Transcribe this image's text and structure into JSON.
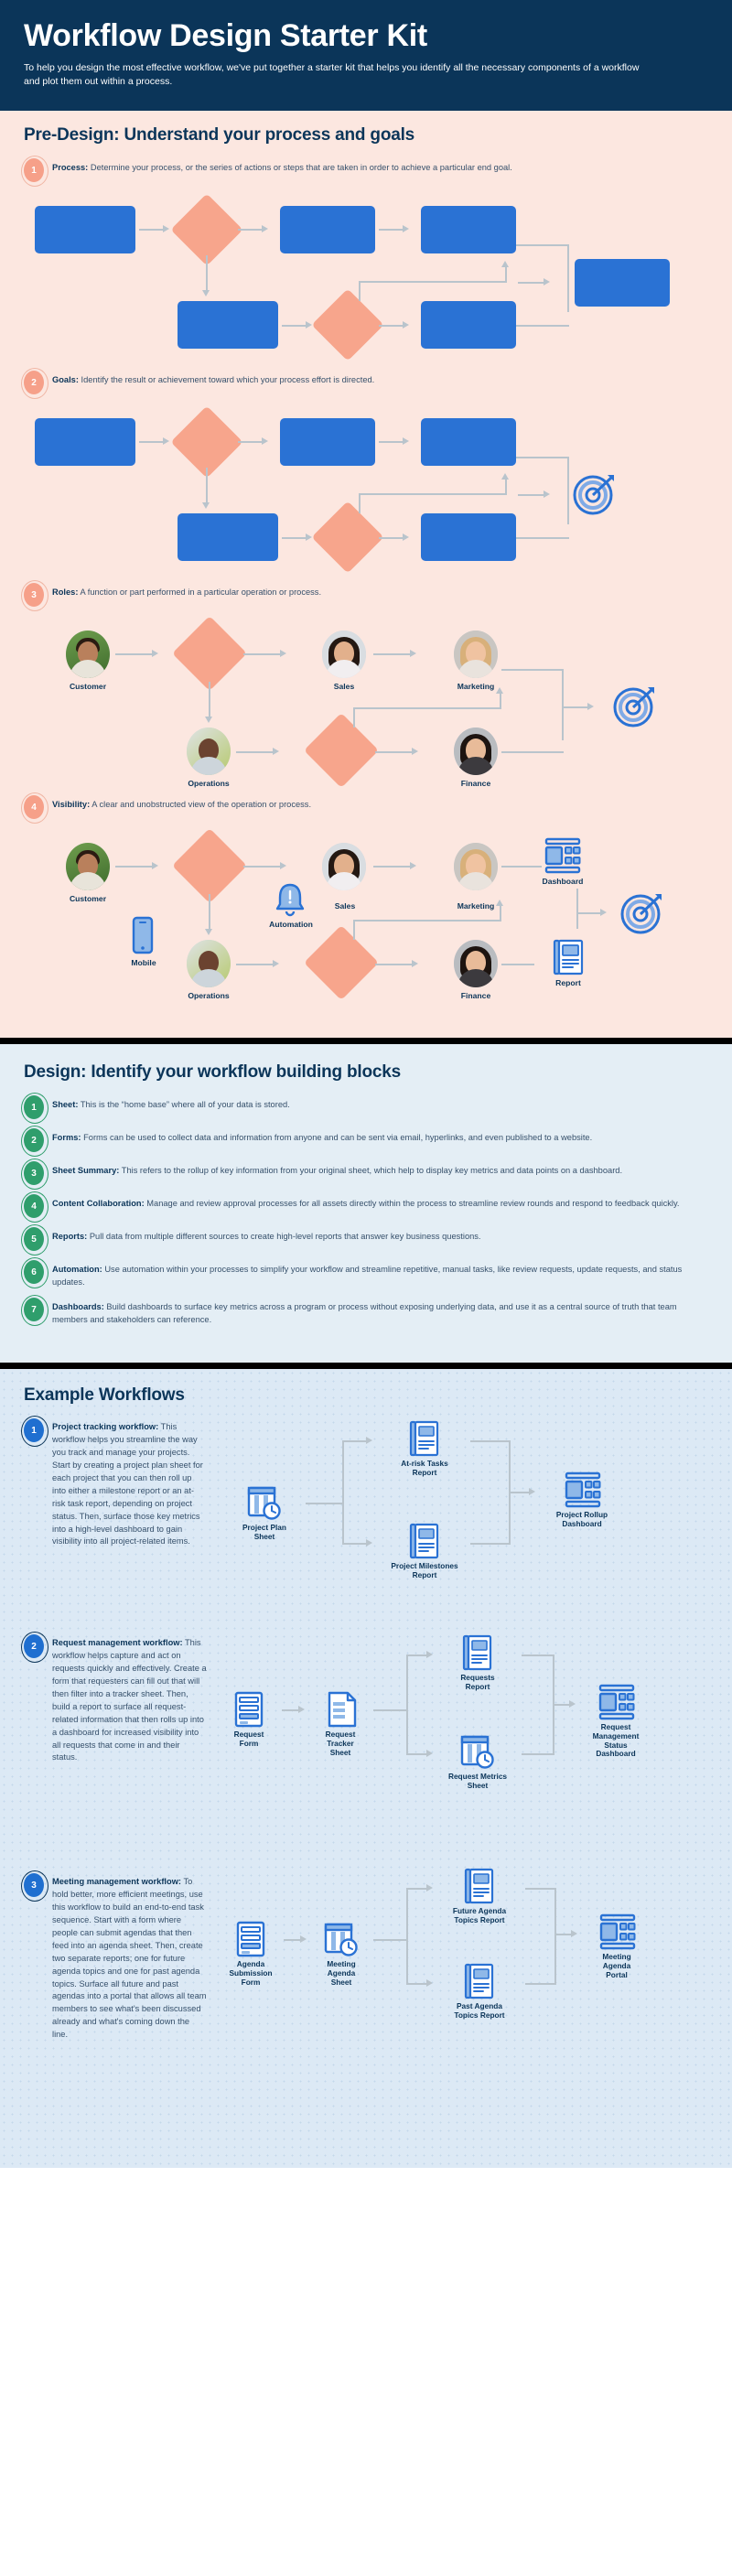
{
  "hero": {
    "title": "Workflow Design Starter Kit",
    "subtitle": "To help you design the most effective workflow, we've put together a starter kit that helps you identify all the necessary components of a workflow and plot them out within a process.",
    "bg_color": "#0b3559"
  },
  "colors": {
    "navy": "#0b3559",
    "salmon": "#f7a58c",
    "blue_box": "#2a72d4",
    "green_badge": "#2f9e6c",
    "blue_badge": "#1f6fd0",
    "predesign_bg": "#fce7e0",
    "design_bg": "#e4eef5",
    "examples_bg": "#dce9f5",
    "arrow_gray": "#b9c4cc"
  },
  "predesign": {
    "heading": "Pre-Design: Understand your process and goals",
    "items": [
      {
        "num": "1",
        "term": "Process:",
        "text": " Determine your process, or the series of actions or steps that are taken in order to achieve a particular end goal."
      },
      {
        "num": "2",
        "term": "Goals:",
        "text": " Identify the result or achievement toward which your process effort is directed."
      },
      {
        "num": "3",
        "term": "Roles:",
        "text": " A function or part performed in a particular operation or process."
      },
      {
        "num": "4",
        "term": "Visibility:",
        "text": " A clear and unobstructed view of the operation or process."
      }
    ],
    "roles_labels": {
      "customer": "Customer",
      "sales": "Sales",
      "marketing": "Marketing",
      "operations": "Operations",
      "finance": "Finance"
    },
    "visibility_labels": {
      "customer": "Customer",
      "mobile": "Mobile",
      "automation": "Automation",
      "sales": "Sales",
      "operations": "Operations",
      "marketing": "Marketing",
      "finance": "Finance",
      "dashboard": "Dashboard",
      "report": "Report"
    }
  },
  "design": {
    "heading": "Design: Identify your workflow building blocks",
    "items": [
      {
        "num": "1",
        "term": "Sheet:",
        "text": " This is the “home base” where all of your data is stored."
      },
      {
        "num": "2",
        "term": "Forms:",
        "text": " Forms can be used to collect data and information from anyone and can be sent via email, hyperlinks, and even published to a website."
      },
      {
        "num": "3",
        "term": "Sheet Summary:",
        "text": " This refers to the rollup of key information from your original sheet, which help to display key metrics and data points on a dashboard."
      },
      {
        "num": "4",
        "term": "Content Collaboration:",
        "text": " Manage and review approval processes for all assets directly within the process to streamline review rounds and respond to feedback quickly."
      },
      {
        "num": "5",
        "term": "Reports:",
        "text": " Pull data from multiple different sources to create high-level reports that answer key business questions."
      },
      {
        "num": "6",
        "term": "Automation:",
        "text": " Use automation within your processes to simplify your workflow and streamline repetitive, manual tasks, like review requests, update requests, and status updates."
      },
      {
        "num": "7",
        "term": "Dashboards:",
        "text": " Build dashboards to surface key metrics across a program or process without exposing underlying data, and use it as a central source of truth that team members and stakeholders can reference."
      }
    ]
  },
  "examples": {
    "heading": "Example Workflows",
    "items": [
      {
        "num": "1",
        "term": "Project tracking workflow:",
        "text": " This workflow helps you streamline the way you track and manage your projects. Start by creating a project plan sheet for each project that you can then roll up into either a milestone report or an at-risk task report, depending on project status. Then, surface those key metrics into a high-level dashboard to gain visibility into all project-related items.",
        "nodes": {
          "start": "Project Plan\nSheet",
          "top": "At-risk Tasks\nReport",
          "bottom": "Project Milestones\nReport",
          "end": "Project Rollup\nDashboard"
        }
      },
      {
        "num": "2",
        "term": "Request management workflow:",
        "text": " This workflow helps capture and act on requests quickly and effectively. Create a form that requesters can fill out that will then filter into a tracker sheet. Then, build a report to surface all request-related information that then rolls up into a dashboard for increased visibility into all requests that come in and their status.",
        "nodes": {
          "start": "Request\nForm",
          "second": "Request\nTracker\nSheet",
          "top": "Requests\nReport",
          "bottom": "Request Metrics\nSheet",
          "end": "Request\nManagement\nStatus\nDashboard"
        }
      },
      {
        "num": "3",
        "term": "Meeting management workflow:",
        "text": " To hold better, more efficient meetings, use this workflow to build an end-to-end task sequence. Start with a form where people can submit agendas that then feed into an agenda sheet. Then, create two separate reports; one for future agenda topics and one for past agenda topics. Surface all future and past agendas into a portal that allows all team members to see what's been discussed already and what's coming down the line.",
        "nodes": {
          "start": "Agenda\nSubmission\nForm",
          "second": "Meeting\nAgenda\nSheet",
          "top": "Future Agenda\nTopics Report",
          "bottom": "Past Agenda\nTopics Report",
          "end": "Meeting\nAgenda\nPortal"
        }
      }
    ]
  }
}
